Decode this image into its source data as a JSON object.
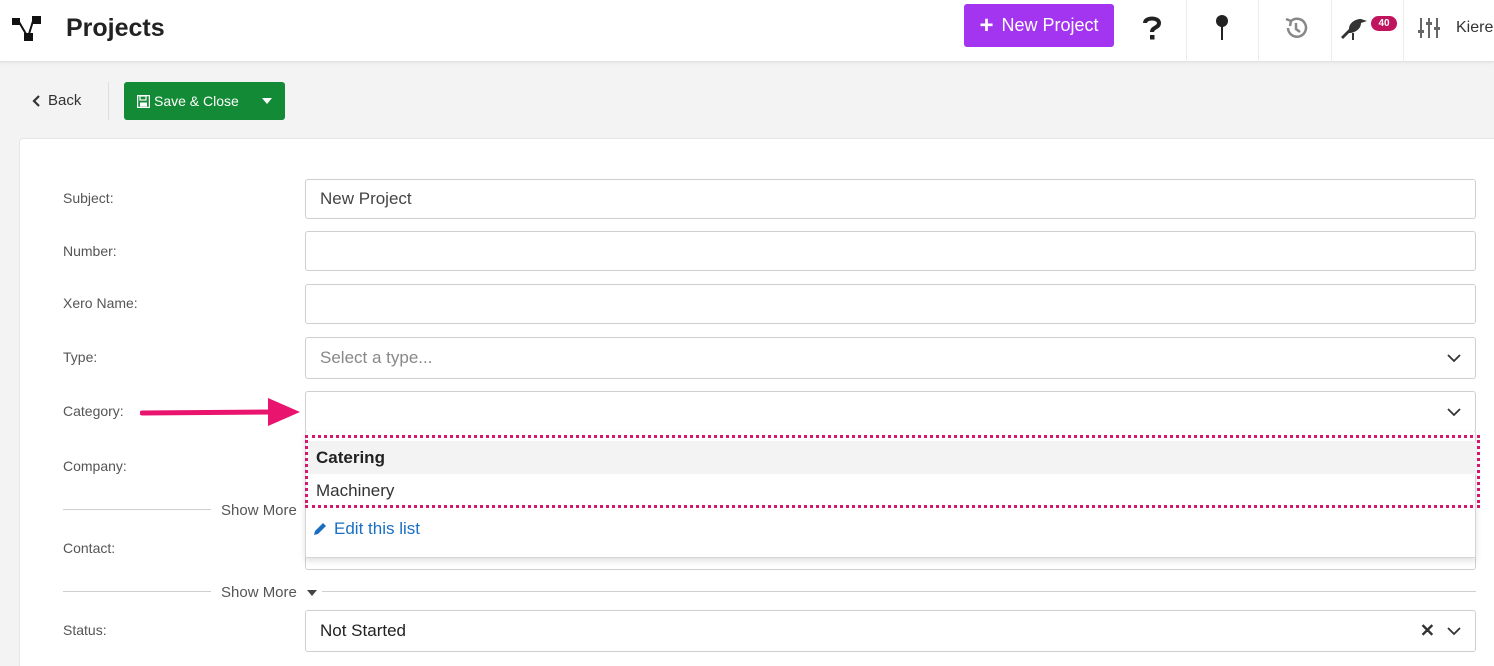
{
  "app": {
    "title": "Projects"
  },
  "header": {
    "new_project_label": "New Project",
    "notification_count": "40",
    "user_name": "Kiere",
    "accent": "#a334f0"
  },
  "toolbar": {
    "back_label": "Back",
    "save_label": "Save & Close",
    "save_color": "#138a36"
  },
  "form": {
    "subject": {
      "label": "Subject:",
      "value": "New Project"
    },
    "number": {
      "label": "Number:",
      "value": ""
    },
    "xero_name": {
      "label": "Xero Name:",
      "value": ""
    },
    "type": {
      "label": "Type:",
      "placeholder": "Select a type..."
    },
    "category": {
      "label": "Category:",
      "value": ""
    },
    "company": {
      "label": "Company:"
    },
    "show_more_1": "Show More",
    "contact": {
      "label": "Contact:"
    },
    "show_more_2": "Show More",
    "status": {
      "label": "Status:",
      "value": "Not Started"
    }
  },
  "category_dropdown": {
    "options": [
      "Catering",
      "Machinery"
    ],
    "edit_label": "Edit this list",
    "highlight_color": "#d6176d"
  },
  "icons": [
    "logo-icon",
    "plus-icon",
    "help-icon",
    "pin-icon",
    "history-icon",
    "bird-icon",
    "settings-sliders-icon",
    "chevron-left-icon",
    "save-icon",
    "caret-down-icon",
    "chevron-down-icon",
    "clear-icon",
    "pencil-icon",
    "arrow-icon"
  ]
}
